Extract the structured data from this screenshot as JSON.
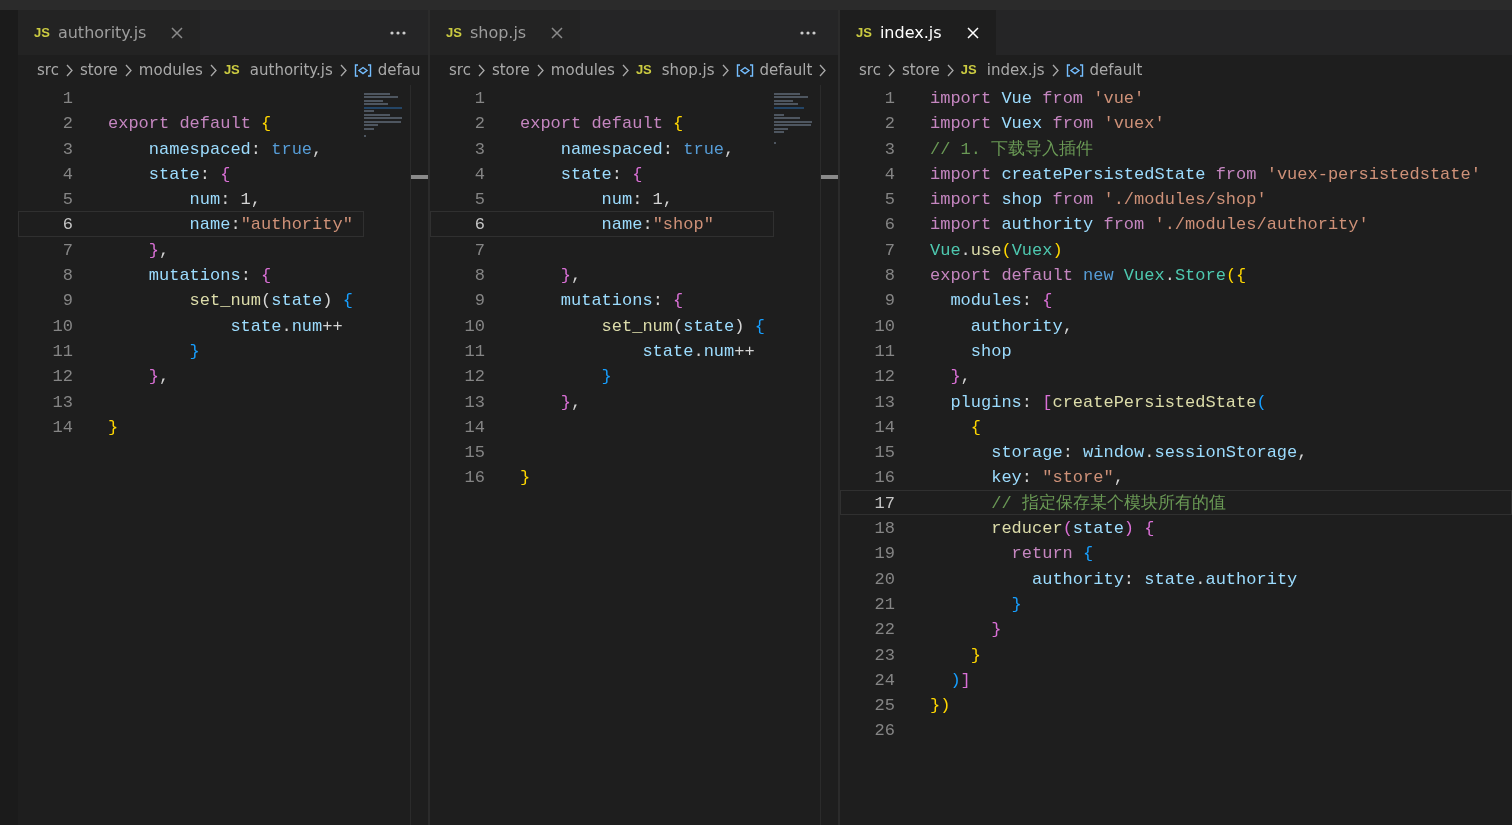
{
  "editors": [
    {
      "tab": {
        "badge": "JS",
        "label": "authority.js",
        "selected": false
      },
      "has_more_menu": true,
      "minimap": true,
      "breadcrumbs": {
        "trailing_chevron": false,
        "items": [
          {
            "kind": "folder",
            "text": "src"
          },
          {
            "kind": "folder",
            "text": "store"
          },
          {
            "kind": "folder",
            "text": "modules"
          },
          {
            "kind": "file",
            "badge": "JS",
            "text": "authority.js"
          },
          {
            "kind": "symbol",
            "text": "defau"
          }
        ]
      },
      "lines": [
        {
          "n": "1",
          "selected": false
        },
        {
          "n": "2",
          "selected": false,
          "tokens": [
            {
              "kind": "kw",
              "text": "export"
            },
            {
              "kind": "kw",
              "text": " default"
            },
            {
              "kind": "b1",
              "text": " {"
            }
          ]
        },
        {
          "n": "3",
          "selected": false,
          "tokens": [
            {
              "kind": "var",
              "text": "    namespaced"
            },
            {
              "kind": "txt",
              "text": ":"
            },
            {
              "kind": "const",
              "text": " true"
            },
            {
              "kind": "txt",
              "text": ","
            }
          ]
        },
        {
          "n": "4",
          "selected": false,
          "tokens": [
            {
              "kind": "var",
              "text": "    state"
            },
            {
              "kind": "txt",
              "text": ":"
            },
            {
              "kind": "b2",
              "text": " {"
            }
          ]
        },
        {
          "n": "5",
          "selected": false,
          "tokens": [
            {
              "kind": "var",
              "text": "        num"
            },
            {
              "kind": "txt",
              "text": ": 1,"
            }
          ]
        },
        {
          "n": "6",
          "selected": true,
          "tokens": [
            {
              "kind": "var",
              "text": "        name"
            },
            {
              "kind": "txt",
              "text": ":"
            },
            {
              "kind": "str",
              "text": "\"authority\""
            }
          ]
        },
        {
          "n": "7",
          "selected": false,
          "tokens": [
            {
              "kind": "b2",
              "text": "    }"
            },
            {
              "kind": "txt",
              "text": ","
            }
          ]
        },
        {
          "n": "8",
          "selected": false,
          "tokens": [
            {
              "kind": "var",
              "text": "    mutations"
            },
            {
              "kind": "txt",
              "text": ":"
            },
            {
              "kind": "b2",
              "text": " {"
            }
          ]
        },
        {
          "n": "9",
          "selected": false,
          "tokens": [
            {
              "kind": "fn",
              "text": "        set_num"
            },
            {
              "kind": "txt",
              "text": "("
            },
            {
              "kind": "var",
              "text": "state"
            },
            {
              "kind": "txt",
              "text": ")"
            },
            {
              "kind": "b3",
              "text": " {"
            }
          ]
        },
        {
          "n": "10",
          "selected": false,
          "tokens": [
            {
              "kind": "var",
              "text": "            state"
            },
            {
              "kind": "txt",
              "text": "."
            },
            {
              "kind": "var",
              "text": "num"
            },
            {
              "kind": "txt",
              "text": "++"
            }
          ]
        },
        {
          "n": "11",
          "selected": false,
          "tokens": [
            {
              "kind": "b3",
              "text": "        }"
            }
          ]
        },
        {
          "n": "12",
          "selected": false,
          "tokens": [
            {
              "kind": "b2",
              "text": "    }"
            },
            {
              "kind": "txt",
              "text": ","
            }
          ]
        },
        {
          "n": "13",
          "selected": false
        },
        {
          "n": "14",
          "selected": false,
          "tokens": [
            {
              "kind": "b1",
              "text": "}"
            }
          ]
        }
      ]
    },
    {
      "tab": {
        "badge": "JS",
        "label": "shop.js",
        "selected": false
      },
      "has_more_menu": true,
      "minimap": true,
      "breadcrumbs": {
        "trailing_chevron": true,
        "items": [
          {
            "kind": "folder",
            "text": "src"
          },
          {
            "kind": "folder",
            "text": "store"
          },
          {
            "kind": "folder",
            "text": "modules"
          },
          {
            "kind": "file",
            "badge": "JS",
            "text": "shop.js"
          },
          {
            "kind": "symbol",
            "text": "default"
          }
        ]
      },
      "lines": [
        {
          "n": "1",
          "selected": false
        },
        {
          "n": "2",
          "selected": false,
          "tokens": [
            {
              "kind": "kw",
              "text": "export"
            },
            {
              "kind": "kw",
              "text": " default"
            },
            {
              "kind": "b1",
              "text": " {"
            }
          ]
        },
        {
          "n": "3",
          "selected": false,
          "tokens": [
            {
              "kind": "var",
              "text": "    namespaced"
            },
            {
              "kind": "txt",
              "text": ":"
            },
            {
              "kind": "const",
              "text": " true"
            },
            {
              "kind": "txt",
              "text": ","
            }
          ]
        },
        {
          "n": "4",
          "selected": false,
          "tokens": [
            {
              "kind": "var",
              "text": "    state"
            },
            {
              "kind": "txt",
              "text": ":"
            },
            {
              "kind": "b2",
              "text": " {"
            }
          ]
        },
        {
          "n": "5",
          "selected": false,
          "tokens": [
            {
              "kind": "var",
              "text": "        num"
            },
            {
              "kind": "txt",
              "text": ": 1,"
            }
          ]
        },
        {
          "n": "6",
          "selected": true,
          "tokens": [
            {
              "kind": "var",
              "text": "        name"
            },
            {
              "kind": "txt",
              "text": ":"
            },
            {
              "kind": "str",
              "text": "\"shop\""
            }
          ]
        },
        {
          "n": "7",
          "selected": false
        },
        {
          "n": "8",
          "selected": false,
          "tokens": [
            {
              "kind": "b2",
              "text": "    }"
            },
            {
              "kind": "txt",
              "text": ","
            }
          ]
        },
        {
          "n": "9",
          "selected": false,
          "tokens": [
            {
              "kind": "var",
              "text": "    mutations"
            },
            {
              "kind": "txt",
              "text": ":"
            },
            {
              "kind": "b2",
              "text": " {"
            }
          ]
        },
        {
          "n": "10",
          "selected": false,
          "tokens": [
            {
              "kind": "fn",
              "text": "        set_num"
            },
            {
              "kind": "txt",
              "text": "("
            },
            {
              "kind": "var",
              "text": "state"
            },
            {
              "kind": "txt",
              "text": ")"
            },
            {
              "kind": "b3",
              "text": " {"
            }
          ]
        },
        {
          "n": "11",
          "selected": false,
          "tokens": [
            {
              "kind": "var",
              "text": "            state"
            },
            {
              "kind": "txt",
              "text": "."
            },
            {
              "kind": "var",
              "text": "num"
            },
            {
              "kind": "txt",
              "text": "++"
            }
          ]
        },
        {
          "n": "12",
          "selected": false,
          "tokens": [
            {
              "kind": "b3",
              "text": "        }"
            }
          ]
        },
        {
          "n": "13",
          "selected": false,
          "tokens": [
            {
              "kind": "b2",
              "text": "    }"
            },
            {
              "kind": "txt",
              "text": ","
            }
          ]
        },
        {
          "n": "14",
          "selected": false
        },
        {
          "n": "15",
          "selected": false
        },
        {
          "n": "16",
          "selected": false,
          "tokens": [
            {
              "kind": "b1",
              "text": "}"
            }
          ]
        }
      ]
    },
    {
      "tab": {
        "badge": "JS",
        "label": "index.js",
        "selected": true
      },
      "has_more_menu": false,
      "minimap": false,
      "breadcrumbs": {
        "trailing_chevron": false,
        "items": [
          {
            "kind": "folder",
            "text": "src"
          },
          {
            "kind": "folder",
            "text": "store"
          },
          {
            "kind": "file",
            "badge": "JS",
            "text": "index.js"
          },
          {
            "kind": "symbol",
            "text": "default"
          }
        ]
      },
      "lines": [
        {
          "n": "1",
          "selected": false,
          "tokens": [
            {
              "kind": "kw",
              "text": "import"
            },
            {
              "kind": "var",
              "text": " Vue"
            },
            {
              "kind": "kw",
              "text": " from"
            },
            {
              "kind": "str",
              "text": " 'vue'"
            }
          ]
        },
        {
          "n": "2",
          "selected": false,
          "tokens": [
            {
              "kind": "kw",
              "text": "import"
            },
            {
              "kind": "var",
              "text": " Vuex"
            },
            {
              "kind": "kw",
              "text": " from"
            },
            {
              "kind": "str",
              "text": " 'vuex'"
            }
          ]
        },
        {
          "n": "3",
          "selected": false,
          "tokens": [
            {
              "kind": "cmt",
              "text": "// 1. 下载导入插件"
            }
          ]
        },
        {
          "n": "4",
          "selected": false,
          "tokens": [
            {
              "kind": "kw",
              "text": "import"
            },
            {
              "kind": "var",
              "text": " createPersistedState"
            },
            {
              "kind": "kw",
              "text": " from"
            },
            {
              "kind": "str",
              "text": " 'vuex-persistedstate'"
            }
          ]
        },
        {
          "n": "5",
          "selected": false,
          "tokens": [
            {
              "kind": "kw",
              "text": "import"
            },
            {
              "kind": "var",
              "text": " shop"
            },
            {
              "kind": "kw",
              "text": " from"
            },
            {
              "kind": "str",
              "text": " './modules/shop'"
            }
          ]
        },
        {
          "n": "6",
          "selected": false,
          "tokens": [
            {
              "kind": "kw",
              "text": "import"
            },
            {
              "kind": "var",
              "text": " authority"
            },
            {
              "kind": "kw",
              "text": " from"
            },
            {
              "kind": "str",
              "text": " './modules/authority'"
            }
          ]
        },
        {
          "n": "7",
          "selected": false,
          "tokens": [
            {
              "kind": "cls",
              "text": "Vue"
            },
            {
              "kind": "txt",
              "text": "."
            },
            {
              "kind": "fn",
              "text": "use"
            },
            {
              "kind": "b1",
              "text": "("
            },
            {
              "kind": "cls",
              "text": "Vuex"
            },
            {
              "kind": "b1",
              "text": ")"
            }
          ]
        },
        {
          "n": "8",
          "selected": false,
          "tokens": [
            {
              "kind": "kw",
              "text": "export"
            },
            {
              "kind": "kw",
              "text": " default"
            },
            {
              "kind": "const",
              "text": " new"
            },
            {
              "kind": "cls",
              "text": " Vuex"
            },
            {
              "kind": "txt",
              "text": "."
            },
            {
              "kind": "cls",
              "text": "Store"
            },
            {
              "kind": "b1",
              "text": "({"
            }
          ]
        },
        {
          "n": "9",
          "selected": false,
          "tokens": [
            {
              "kind": "var",
              "text": "  modules"
            },
            {
              "kind": "txt",
              "text": ":"
            },
            {
              "kind": "b2",
              "text": " {"
            }
          ]
        },
        {
          "n": "10",
          "selected": false,
          "tokens": [
            {
              "kind": "var",
              "text": "    authority"
            },
            {
              "kind": "txt",
              "text": ","
            }
          ]
        },
        {
          "n": "11",
          "selected": false,
          "tokens": [
            {
              "kind": "var",
              "text": "    shop"
            }
          ]
        },
        {
          "n": "12",
          "selected": false,
          "tokens": [
            {
              "kind": "b2",
              "text": "  }"
            },
            {
              "kind": "txt",
              "text": ","
            }
          ]
        },
        {
          "n": "13",
          "selected": false,
          "tokens": [
            {
              "kind": "var",
              "text": "  plugins"
            },
            {
              "kind": "txt",
              "text": ":"
            },
            {
              "kind": "b2",
              "text": " ["
            },
            {
              "kind": "fn",
              "text": "createPersistedState"
            },
            {
              "kind": "b3",
              "text": "("
            }
          ]
        },
        {
          "n": "14",
          "selected": false,
          "tokens": [
            {
              "kind": "b1",
              "text": "    {"
            }
          ]
        },
        {
          "n": "15",
          "selected": false,
          "tokens": [
            {
              "kind": "var",
              "text": "      storage"
            },
            {
              "kind": "txt",
              "text": ":"
            },
            {
              "kind": "var",
              "text": " window"
            },
            {
              "kind": "txt",
              "text": "."
            },
            {
              "kind": "var",
              "text": "sessionStorage"
            },
            {
              "kind": "txt",
              "text": ","
            }
          ]
        },
        {
          "n": "16",
          "selected": false,
          "tokens": [
            {
              "kind": "var",
              "text": "      key"
            },
            {
              "kind": "txt",
              "text": ":"
            },
            {
              "kind": "str",
              "text": " \"store\""
            },
            {
              "kind": "txt",
              "text": ","
            }
          ]
        },
        {
          "n": "17",
          "selected": true,
          "tokens": [
            {
              "kind": "cmt",
              "text": "      // 指定保存某个模块所有的值"
            }
          ]
        },
        {
          "n": "18",
          "selected": false,
          "tokens": [
            {
              "kind": "fn",
              "text": "      reducer"
            },
            {
              "kind": "b2",
              "text": "("
            },
            {
              "kind": "var",
              "text": "state"
            },
            {
              "kind": "b2",
              "text": ")"
            },
            {
              "kind": "b2",
              "text": " {"
            }
          ]
        },
        {
          "n": "19",
          "selected": false,
          "tokens": [
            {
              "kind": "kw",
              "text": "        return"
            },
            {
              "kind": "b3",
              "text": " {"
            }
          ]
        },
        {
          "n": "20",
          "selected": false,
          "tokens": [
            {
              "kind": "var",
              "text": "          authority"
            },
            {
              "kind": "txt",
              "text": ":"
            },
            {
              "kind": "var",
              "text": " state"
            },
            {
              "kind": "txt",
              "text": "."
            },
            {
              "kind": "var",
              "text": "authority"
            }
          ]
        },
        {
          "n": "21",
          "selected": false,
          "tokens": [
            {
              "kind": "b3",
              "text": "        }"
            }
          ]
        },
        {
          "n": "22",
          "selected": false,
          "tokens": [
            {
              "kind": "b2",
              "text": "      }"
            }
          ]
        },
        {
          "n": "23",
          "selected": false,
          "tokens": [
            {
              "kind": "b1",
              "text": "    }"
            }
          ]
        },
        {
          "n": "24",
          "selected": false,
          "tokens": [
            {
              "kind": "b3",
              "text": "  )"
            },
            {
              "kind": "b2",
              "text": "]"
            }
          ]
        },
        {
          "n": "25",
          "selected": false,
          "tokens": [
            {
              "kind": "b1",
              "text": "})"
            }
          ]
        },
        {
          "n": "26",
          "selected": false
        }
      ]
    }
  ]
}
